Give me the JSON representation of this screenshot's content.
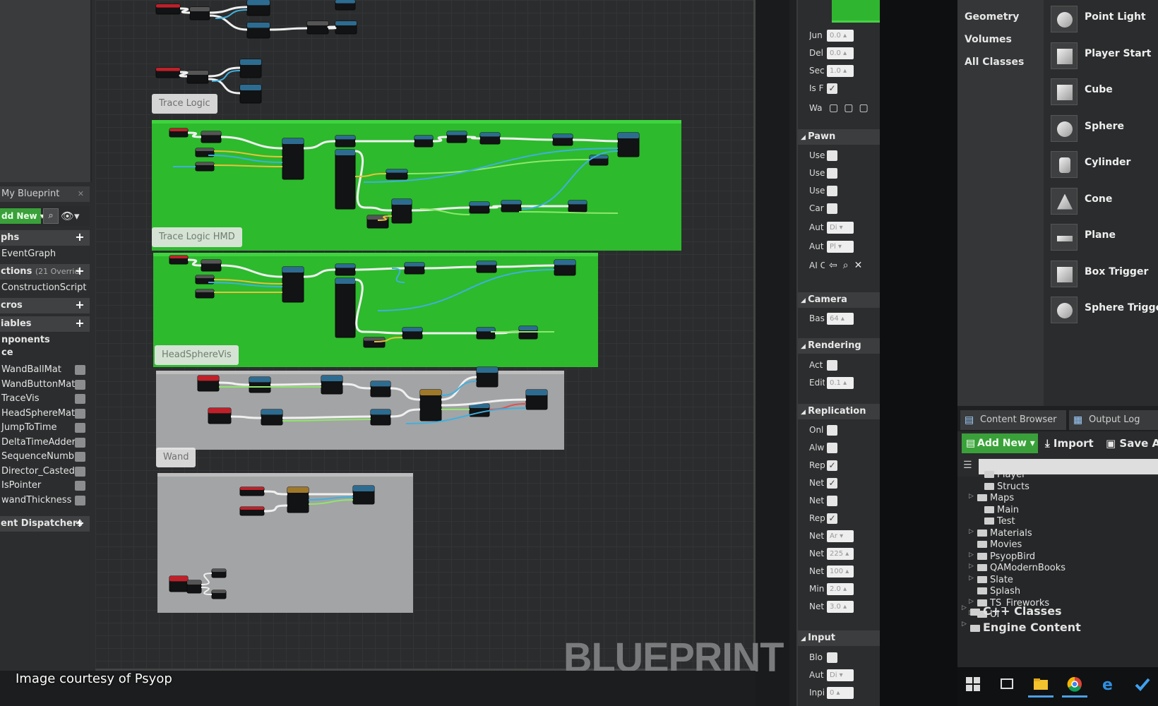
{
  "my_blueprint": {
    "tab_title": "My Blueprint",
    "add_new_label": "dd New ▾",
    "sections": {
      "graphs": "phs",
      "event_graph": "EventGraph",
      "functions": "ctions",
      "functions_overrides": "(21 Overrid",
      "construction_script": "ConstructionScript",
      "macros": "cros",
      "variables": "iables",
      "components": "nponents",
      "components_sub": "ce",
      "event_dispatchers": "ent Dispatchers"
    },
    "variables": [
      "WandBallMat",
      "WandButtonMat",
      "TraceVis",
      "HeadSphereMat",
      "JumpToTime",
      "DeltaTimeAdder",
      "SequenceNumb",
      "Director_Casted",
      "IsPointer",
      "wandThickness"
    ]
  },
  "graph": {
    "comments": [
      "Trace Logic",
      "Trace Logic HMD",
      "HeadSphereVis",
      "Wand"
    ],
    "watermark": "BLUEPRINT"
  },
  "details": {
    "rows_top": [
      {
        "label": "Jun",
        "value": "0.0 ▴"
      },
      {
        "label": "Del",
        "value": "0.0 ▴"
      },
      {
        "label": "Sec",
        "value": "1.0 ▴"
      }
    ],
    "isf_label": "Is F",
    "wa_label": "Wa",
    "categories": {
      "pawn": "Pawn",
      "camera": "Camera",
      "rendering": "Rendering",
      "replication": "Replication",
      "input": "Input"
    },
    "pawn_rows": [
      "Use",
      "Use",
      "Use",
      "Car"
    ],
    "pawn_fields": [
      {
        "label": "Aut",
        "value": "Di ▾"
      },
      {
        "label": "Aut",
        "value": "Pl ▾"
      }
    ],
    "ai_label": "AI C",
    "camera_row": {
      "label": "Bas",
      "value": "64 ▴"
    },
    "rendering_rows": [
      {
        "label": "Act"
      },
      {
        "label": "Edit",
        "value": "0.1 ▴"
      }
    ],
    "replication_checks": [
      "Onl",
      "Alw",
      "Rep",
      "Net",
      "Net",
      "Rep"
    ],
    "replication_fields": [
      {
        "label": "Net",
        "value": "Ar ▾"
      },
      {
        "label": "Net",
        "value": "225 ▴"
      },
      {
        "label": "Net",
        "value": "100 ▴"
      },
      {
        "label": "Min",
        "value": "2.0 ▴"
      },
      {
        "label": "Net",
        "value": "3.0 ▴"
      }
    ],
    "input_rows": [
      {
        "label": "Blo"
      },
      {
        "label": "Aut",
        "value": "Di ▾"
      },
      {
        "label": "Inpi",
        "value": "0 ▴"
      }
    ]
  },
  "place_panel": {
    "categories": [
      "Geometry",
      "Volumes",
      "All Classes"
    ],
    "items": [
      "Point Light",
      "Player Start",
      "Cube",
      "Sphere",
      "Cylinder",
      "Cone",
      "Plane",
      "Box Trigger",
      "Sphere Trigger"
    ]
  },
  "content_browser": {
    "tabs": [
      "Content Browser",
      "Output Log"
    ],
    "add_new": "Add New ▾",
    "import": "Import",
    "save": "Save A",
    "tree": [
      "Player",
      "Structs",
      "Maps",
      "Main",
      "Test",
      "Materials",
      "Movies",
      "PsyopBird",
      "QAModernBooks",
      "Slate",
      "Splash",
      "TS_Fireworks",
      "UI",
      "C++ Classes",
      "Engine Content"
    ]
  },
  "credit": "Image courtesy of Psyop",
  "colors": {
    "comment_green": "#2dba2d",
    "comment_gray": "#a3a4a5",
    "exec_wire": "#f0f0f0",
    "data_wire_blue": "#3fb0e0",
    "data_wire_yellow": "#e8c23a",
    "data_wire_green": "#8ee86a",
    "accent_button": "#3aa13a"
  }
}
